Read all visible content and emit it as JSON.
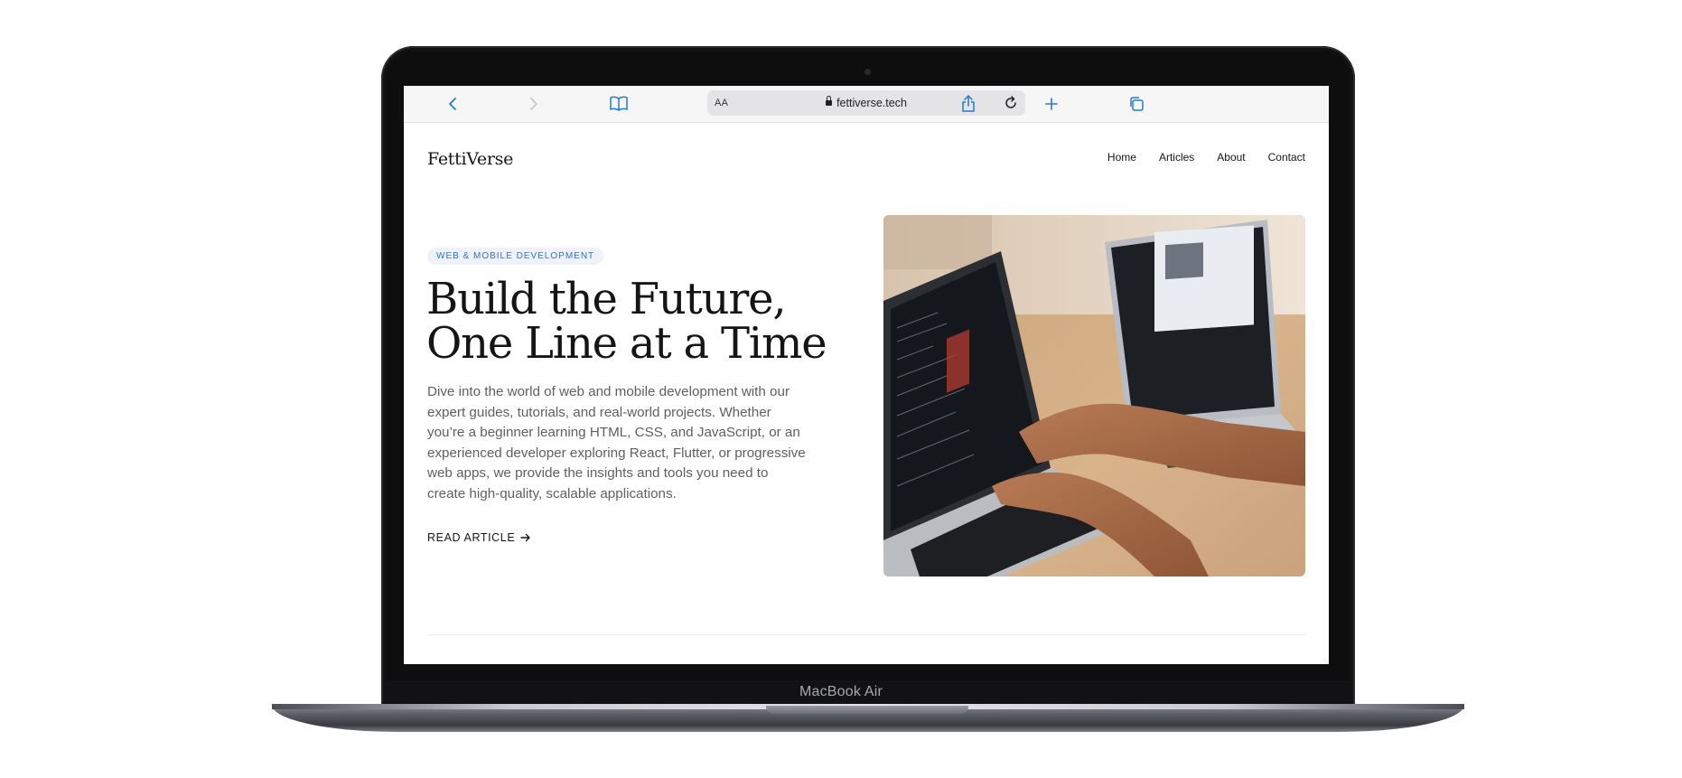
{
  "device": {
    "label": "MacBook Air"
  },
  "browser": {
    "text_size_label": "AA",
    "url": "fettiverse.tech",
    "icons": [
      "back-icon",
      "forward-icon",
      "bookmarks-icon",
      "reload-icon",
      "share-icon",
      "new-tab-icon",
      "tabs-icon"
    ]
  },
  "site": {
    "brand": "FettiVerse",
    "nav": [
      "Home",
      "Articles",
      "About",
      "Contact"
    ],
    "hero": {
      "tag": "WEB & MOBILE DEVELOPMENT",
      "headline_line1": "Build the Future,",
      "headline_line2": "One Line at a Time",
      "lede": "Dive into the world of web and mobile development with our expert guides, tutorials, and real-world projects. Whether you’re a beginner learning HTML, CSS, and JavaScript, or an experienced developer exploring React, Flutter, or progressive web apps, we provide the insights and tools you need to create high-quality, scalable applications.",
      "cta": "READ ARTICLE",
      "image_subject": "two-laptops-coding-photo"
    }
  },
  "colors": {
    "accent": "#1f7bd8",
    "tag_bg": "#eef3fb",
    "tag_text": "#2f74d0",
    "text": "#151515",
    "muted": "#5f5f63"
  }
}
